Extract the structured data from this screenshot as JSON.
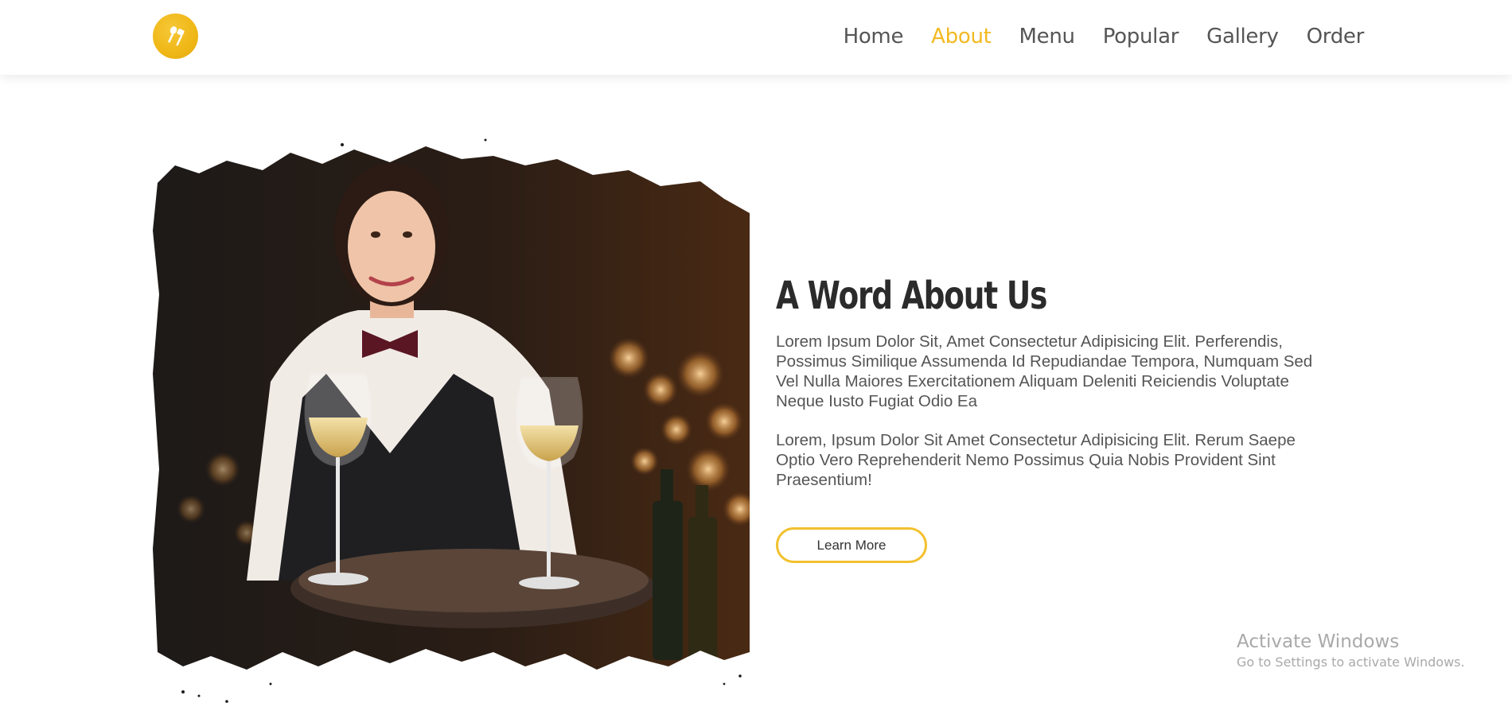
{
  "header": {
    "logo_icon": "utensils-icon",
    "nav": [
      {
        "label": "Home",
        "active": false
      },
      {
        "label": "About",
        "active": true
      },
      {
        "label": "Menu",
        "active": false
      },
      {
        "label": "Popular",
        "active": false
      },
      {
        "label": "Gallery",
        "active": false
      },
      {
        "label": "Order",
        "active": false
      }
    ]
  },
  "about": {
    "image_alt": "waitress-with-wine-tray",
    "title": "A Word About Us",
    "paragraph_1": "Lorem Ipsum Dolor Sit, Amet Consectetur Adipisicing Elit. Perferendis, Possimus Similique Assumenda Id Repudiandae Tempora, Numquam Sed Vel Nulla Maiores Exercitationem Aliquam Deleniti Reiciendis Voluptate Neque Iusto Fugiat Odio Ea",
    "paragraph_2": "Lorem, Ipsum Dolor Sit Amet Consectetur Adipisicing Elit. Rerum Saepe Optio Vero Reprehenderit Nemo Possimus Quia Nobis Provident Sint Praesentium!",
    "button_label": "Learn More"
  },
  "watermark": {
    "title": "Activate Windows",
    "subtitle": "Go to Settings to activate Windows."
  },
  "colors": {
    "accent": "#f2b922",
    "nav_text": "#555555",
    "heading": "#2b2b2b",
    "body_text": "#555555"
  }
}
